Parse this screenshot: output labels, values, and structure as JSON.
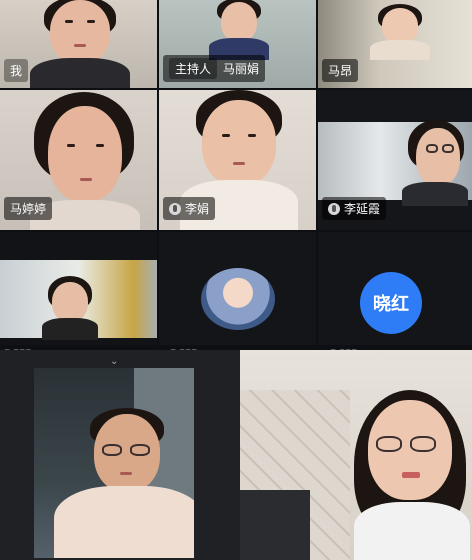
{
  "participants": [
    {
      "id": "me",
      "name": "我"
    },
    {
      "id": "host",
      "role": "主持人",
      "name": "马丽娟"
    },
    {
      "id": "maang",
      "name": "马昂"
    },
    {
      "id": "matingting",
      "name": "马婷婷"
    },
    {
      "id": "lijuan",
      "name": "李娟"
    },
    {
      "id": "liyanxia",
      "name": "李延霞"
    },
    {
      "id": "p7",
      "name": ""
    },
    {
      "id": "p8",
      "name": ""
    },
    {
      "id": "xiaohong",
      "avatar_text": "晓红"
    }
  ],
  "colors": {
    "accent_blue": "#2f7df6",
    "background": "#0e0f12"
  }
}
